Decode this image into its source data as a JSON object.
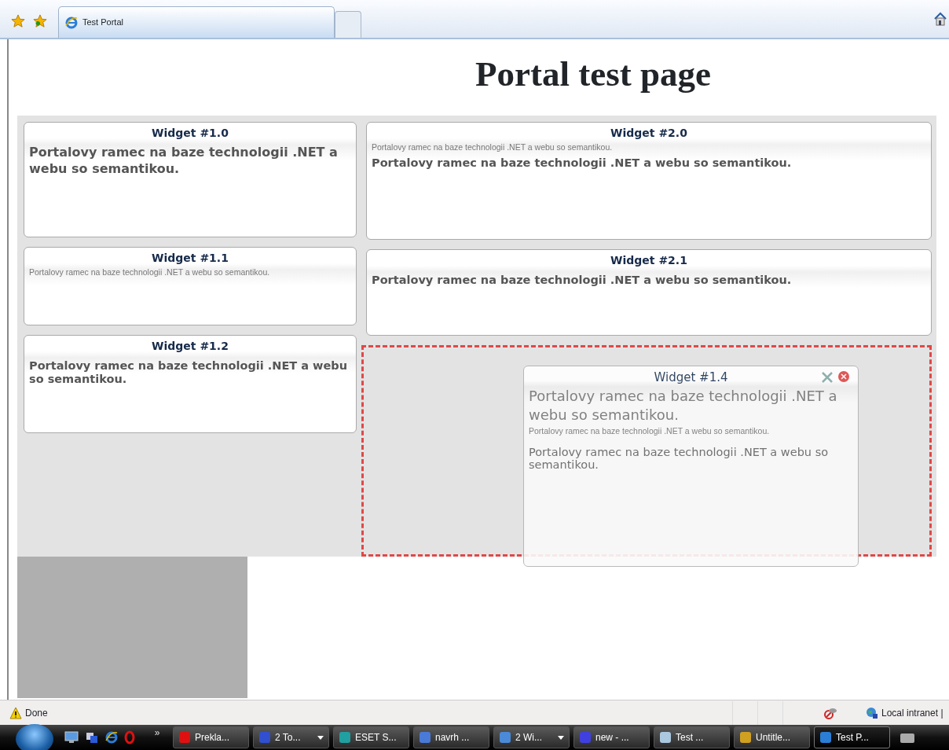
{
  "browser": {
    "tabs": [
      {
        "label": "Test Portal",
        "selected": true
      }
    ]
  },
  "page": {
    "title": "Portal test page",
    "columns": [
      {
        "widgets": [
          {
            "title": "Widget #1.0",
            "paragraphs": [
              {
                "kind": "bold-large",
                "text": "Portalovy ramec na baze technologii .NET a webu so semantikou."
              }
            ]
          },
          {
            "title": "Widget #1.1",
            "paragraphs": [
              {
                "kind": "small",
                "text": "Portalovy ramec na baze technologii .NET a webu so semantikou."
              }
            ]
          },
          {
            "title": "Widget #1.2",
            "paragraphs": [
              {
                "kind": "bold",
                "text": "Portalovy ramec na baze technologii .NET a webu so semantikou."
              }
            ]
          }
        ]
      },
      {
        "widgets": [
          {
            "title": "Widget #2.0",
            "paragraphs": [
              {
                "kind": "small",
                "text": "Portalovy ramec na baze technologii .NET a webu so semantikou."
              },
              {
                "kind": "bold",
                "text": "Portalovy ramec na baze technologii .NET a webu so semantikou."
              }
            ]
          },
          {
            "title": "Widget #2.1",
            "paragraphs": [
              {
                "kind": "bold",
                "text": "Portalovy ramec na baze technologii .NET a webu so semantikou."
              }
            ]
          }
        ],
        "drop_zone": true
      }
    ],
    "dragged_widget": {
      "title": "Widget #1.4",
      "paragraphs": [
        {
          "kind": "light-large",
          "text": "Portalovy ramec na baze technologii .NET a webu so semantikou."
        },
        {
          "kind": "small",
          "text": "Portalovy ramec na baze technologii .NET a webu so semantikou."
        },
        {
          "kind": "light",
          "text": "Portalovy ramec na baze technologii .NET a webu so semantikou."
        }
      ]
    }
  },
  "status_bar": {
    "status": "Done",
    "zone": "Local intranet |"
  },
  "taskbar": {
    "overflow": "»",
    "items": [
      {
        "label": "Prekla...",
        "grouped": false,
        "selected": false
      },
      {
        "label": "2 To...",
        "grouped": true,
        "selected": false
      },
      {
        "label": "ESET S...",
        "grouped": false,
        "selected": false
      },
      {
        "label": "navrh ...",
        "grouped": false,
        "selected": false
      },
      {
        "label": "2 Wi...",
        "grouped": true,
        "selected": false
      },
      {
        "label": "new - ...",
        "grouped": false,
        "selected": false
      },
      {
        "label": "Test ...",
        "grouped": false,
        "selected": false
      },
      {
        "label": "Untitle...",
        "grouped": false,
        "selected": false
      },
      {
        "label": "Test P...",
        "grouped": false,
        "selected": true
      }
    ]
  }
}
